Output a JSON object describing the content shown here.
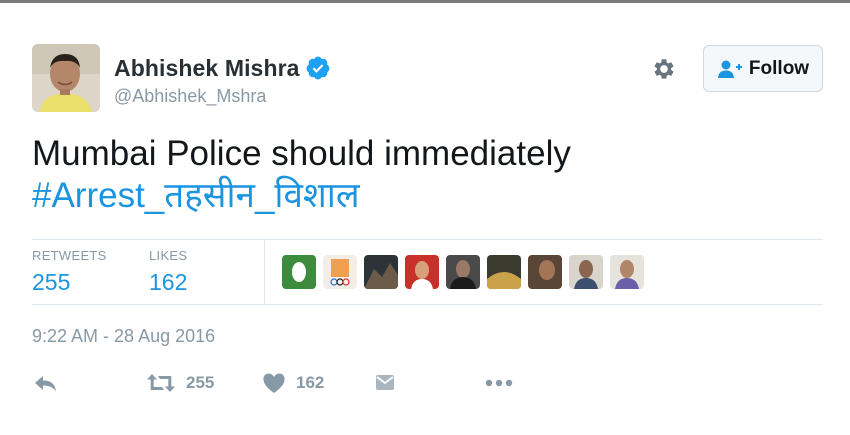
{
  "tweet": {
    "author": {
      "name": "Abhishek Mishra",
      "handle": "@Abhishek_Mshra",
      "verified": true,
      "avatar_icon": "user-avatar"
    },
    "follow_label": "Follow",
    "text_line1": "Mumbai Police should immediately",
    "hashtag": "#Arrest_तहसीन_विशाल",
    "stats": {
      "retweets_label": "RETWEETS",
      "retweets_value": "255",
      "likes_label": "LIKES",
      "likes_value": "162"
    },
    "likers_count_shown": 9,
    "timestamp": "9:22 AM - 28 Aug 2016",
    "actions": {
      "reply_icon": "reply-icon",
      "retweet_icon": "retweet-icon",
      "retweet_count": "255",
      "like_icon": "heart-icon",
      "like_count": "162",
      "dm_icon": "direct-message-icon",
      "more_icon": "more-icon"
    }
  },
  "colors": {
    "accent": "#1b95e0",
    "muted": "#8899a6",
    "text": "#14171a",
    "verified": "#1da1f2"
  }
}
